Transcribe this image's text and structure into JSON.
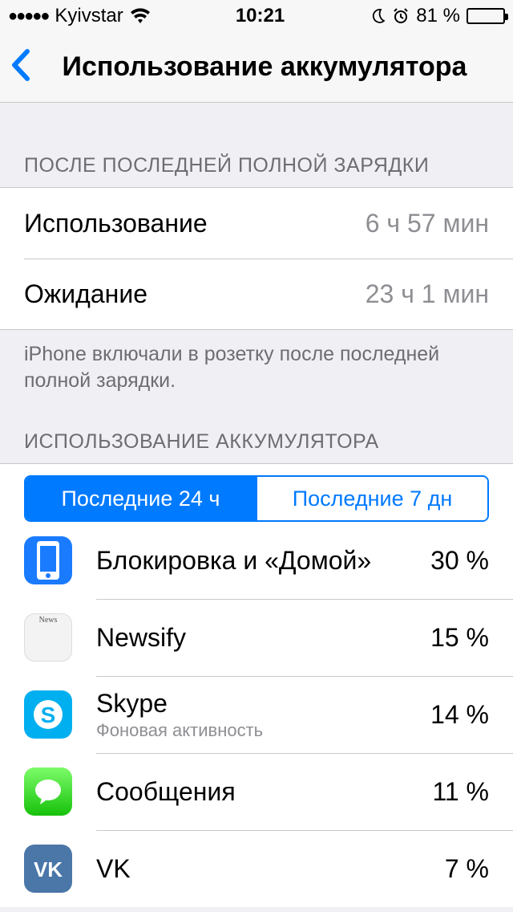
{
  "status": {
    "carrier": "Kyivstar",
    "time": "10:21",
    "battery_percent": "81 %"
  },
  "nav": {
    "title": "Использование аккумулятора"
  },
  "sections": {
    "since_full_charge_header": "ПОСЛЕ ПОСЛЕДНЕЙ ПОЛНОЙ ЗАРЯДКИ",
    "usage_label": "Использование",
    "usage_value": "6 ч 57 мин",
    "standby_label": "Ожидание",
    "standby_value": "23 ч 1 мин",
    "charge_note": "iPhone включали в розетку после последней полной зарядки.",
    "battery_usage_header": "ИСПОЛЬЗОВАНИЕ АККУМУЛЯТОРА"
  },
  "segmented": {
    "last24": "Последние 24 ч",
    "last7d": "Последние 7 дн"
  },
  "apps": [
    {
      "name": "Блокировка и «Домой»",
      "sub": "",
      "percent": "30 %",
      "icon": "lock"
    },
    {
      "name": "Newsify",
      "sub": "",
      "percent": "15 %",
      "icon": "news"
    },
    {
      "name": "Skype",
      "sub": "Фоновая активность",
      "percent": "14 %",
      "icon": "skype"
    },
    {
      "name": "Сообщения",
      "sub": "",
      "percent": "11 %",
      "icon": "messages"
    },
    {
      "name": "VK",
      "sub": "",
      "percent": "7 %",
      "icon": "vk"
    }
  ]
}
